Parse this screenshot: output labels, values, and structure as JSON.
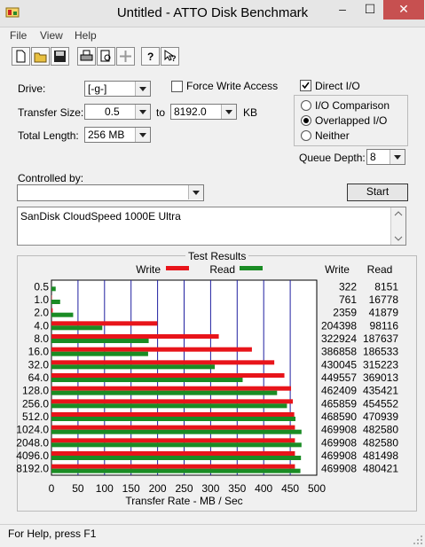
{
  "window": {
    "title": "Untitled - ATTO Disk Benchmark",
    "minimize": "–",
    "maximize": "☐",
    "close": "✕"
  },
  "menu": [
    "File",
    "View",
    "Help"
  ],
  "toolbar_icons": [
    "new-file-icon",
    "open-folder-icon",
    "save-icon",
    "print-icon",
    "print-preview-icon",
    "move-icon",
    "help-icon",
    "context-help-icon"
  ],
  "form": {
    "drive_label": "Drive:",
    "drive_value": "[-g-]",
    "force_write_label": "Force Write Access",
    "force_write_checked": false,
    "direct_io_label": "Direct I/O",
    "direct_io_checked": true,
    "transfer_size_label": "Transfer Size:",
    "transfer_from": "0.5",
    "to_label": "to",
    "transfer_to": "8192.0",
    "kb_label": "KB",
    "total_length_label": "Total Length:",
    "total_length_value": "256 MB",
    "io_options": [
      {
        "label": "I/O Comparison",
        "selected": false
      },
      {
        "label": "Overlapped I/O",
        "selected": true
      },
      {
        "label": "Neither",
        "selected": false
      }
    ],
    "queue_depth_label": "Queue Depth:",
    "queue_depth_value": "8",
    "controlled_by_label": "Controlled by:",
    "controlled_by_value": "",
    "start_label": "Start",
    "description": "SanDisk CloudSpeed 1000E Ultra"
  },
  "results": {
    "title": "Test Results",
    "write_label": "Write",
    "read_label": "Read",
    "col_write": "Write",
    "col_read": "Read"
  },
  "colors": {
    "write": "#e8141a",
    "read": "#1a8c24",
    "grid": "#2020a0",
    "plot_bg": "#ffffff"
  },
  "chart_data": {
    "type": "bar",
    "orientation": "horizontal",
    "categories": [
      "0.5",
      "1.0",
      "2.0",
      "4.0",
      "8.0",
      "16.0",
      "32.0",
      "64.0",
      "128.0",
      "256.0",
      "512.0",
      "1024.0",
      "2048.0",
      "4096.0",
      "8192.0"
    ],
    "series": [
      {
        "name": "Write",
        "values": [
          322,
          761,
          2359,
          204398,
          322924,
          386858,
          430045,
          449557,
          462409,
          465859,
          468590,
          469908,
          469908,
          469908,
          469908
        ]
      },
      {
        "name": "Read",
        "values": [
          8151,
          16778,
          41879,
          98116,
          187637,
          186533,
          315223,
          369013,
          435421,
          454552,
          470939,
          482580,
          482580,
          481498,
          480421
        ]
      }
    ],
    "write_text": [
      "322",
      "761",
      "2359",
      "204398",
      "322924",
      "386858",
      "430045",
      "449557",
      "462409",
      "465859",
      "468590",
      "469908",
      "469908",
      "469908",
      "469908"
    ],
    "read_text": [
      "8151",
      "16778",
      "41879",
      "98116",
      "187637",
      "186533",
      "315223",
      "369013",
      "435421",
      "454552",
      "470939",
      "482580",
      "482580",
      "481498",
      "480421"
    ],
    "xticks": [
      "0",
      "50",
      "100",
      "150",
      "200",
      "250",
      "300",
      "350",
      "400",
      "450",
      "500"
    ],
    "xlabel": "Transfer Rate - MB / Sec",
    "xlim": [
      0,
      500
    ]
  },
  "status": {
    "text": "For Help, press F1"
  }
}
